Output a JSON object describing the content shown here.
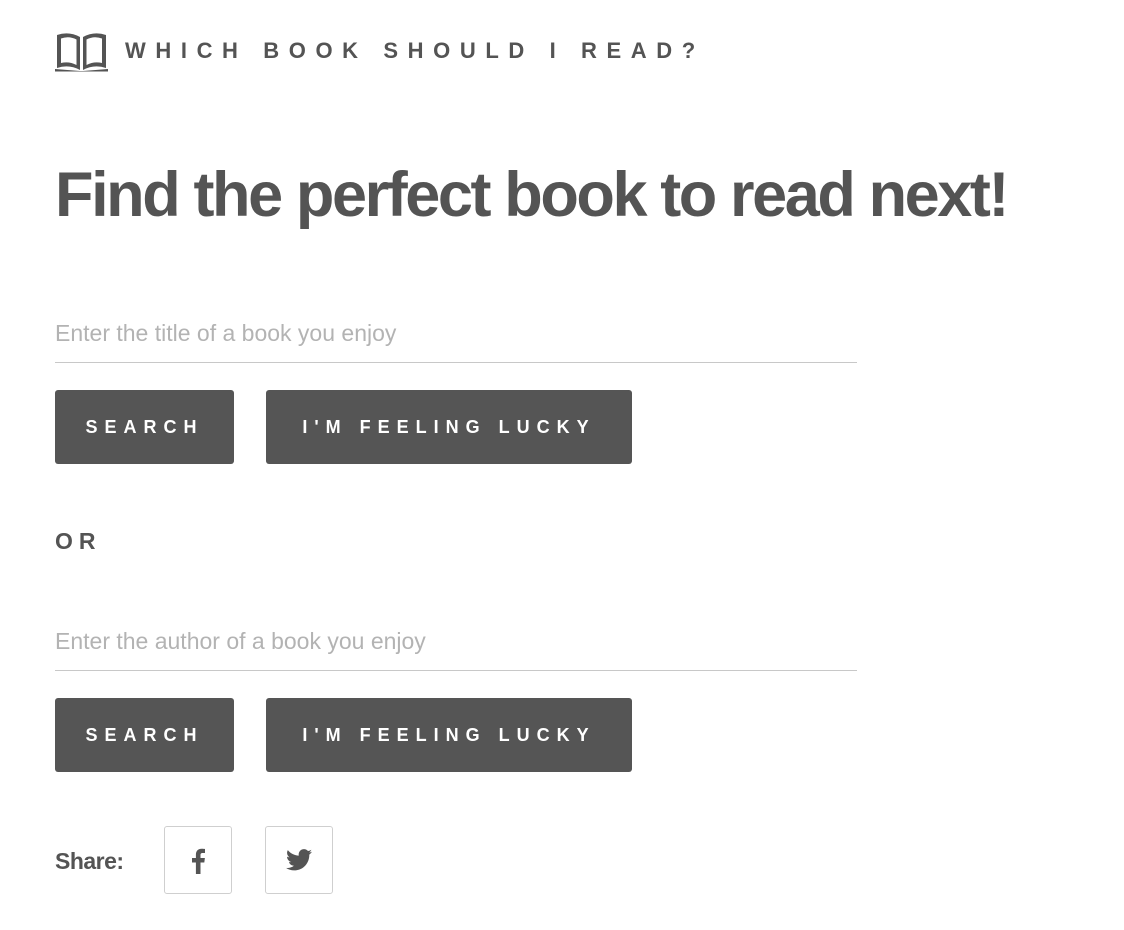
{
  "header": {
    "logo_icon": "open-book-icon",
    "title": "WHICH BOOK SHOULD I READ?"
  },
  "main": {
    "headline": "Find the perfect book to read next!",
    "title_search": {
      "placeholder": "Enter the title of a book you enjoy",
      "value": "",
      "search_label": "SEARCH",
      "lucky_label": "I'M FEELING LUCKY"
    },
    "separator": "OR",
    "author_search": {
      "placeholder": "Enter the author of a book you enjoy",
      "value": "",
      "search_label": "SEARCH",
      "lucky_label": "I'M FEELING LUCKY"
    }
  },
  "share": {
    "label": "Share:",
    "buttons": [
      {
        "icon": "facebook-icon"
      },
      {
        "icon": "twitter-icon"
      }
    ]
  },
  "colors": {
    "text": "#545454",
    "button_bg": "#555555",
    "button_text": "#ffffff",
    "placeholder": "#b3b3b3",
    "divider": "#c8c8c8",
    "border": "#cfcfcf",
    "background": "#ffffff"
  }
}
